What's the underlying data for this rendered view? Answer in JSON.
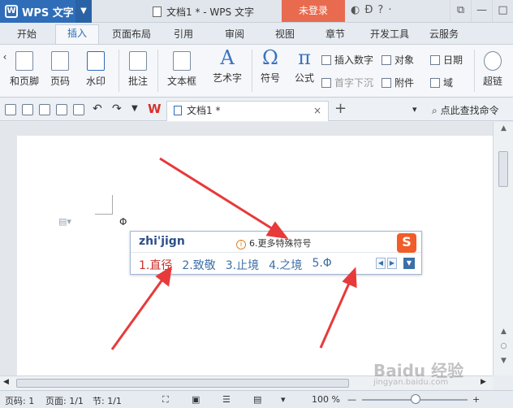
{
  "titlebar": {
    "app_name": "WPS 文字",
    "doc_title": "文档1 * - WPS 文字",
    "login": "未登录"
  },
  "tabs": [
    "开始",
    "插入",
    "页面布局",
    "引用",
    "审阅",
    "视图",
    "章节",
    "开发工具",
    "云服务"
  ],
  "active_tab": "插入",
  "ribbon": {
    "header_footer": "和页脚",
    "page_number": "页码",
    "watermark": "水印",
    "annotation": "批注",
    "textbox": "文本框",
    "art_text": "艺术字",
    "symbol": "符号",
    "formula": "公式",
    "insert_number": "插入数字",
    "object": "对象",
    "date": "日期",
    "drop_cap": "首字下沉",
    "attachment": "附件",
    "field": "域",
    "hyperlink": "超链"
  },
  "doc_tab": {
    "label": "文档1 *",
    "close": "×"
  },
  "search_command": "点此查找命令",
  "ime": {
    "pinyin": "zhi'jign",
    "hint": "6.更多特殊符号",
    "candidates": [
      "1.直径",
      "2.致敬",
      "3.止境",
      "4.之境",
      "5.Φ"
    ],
    "logo": "S"
  },
  "statusbar": {
    "page_num": "页码: 1",
    "pages": "页面: 1/1",
    "section": "节: 1/1",
    "zoom": "100 %"
  },
  "watermark": {
    "text": "Baidu 经验",
    "sub": "jingyan.baidu.com"
  },
  "colors": {
    "app_blue": "#2f6db8",
    "login_orange": "#e86b4f",
    "arrow_red": "#e83a3a"
  }
}
